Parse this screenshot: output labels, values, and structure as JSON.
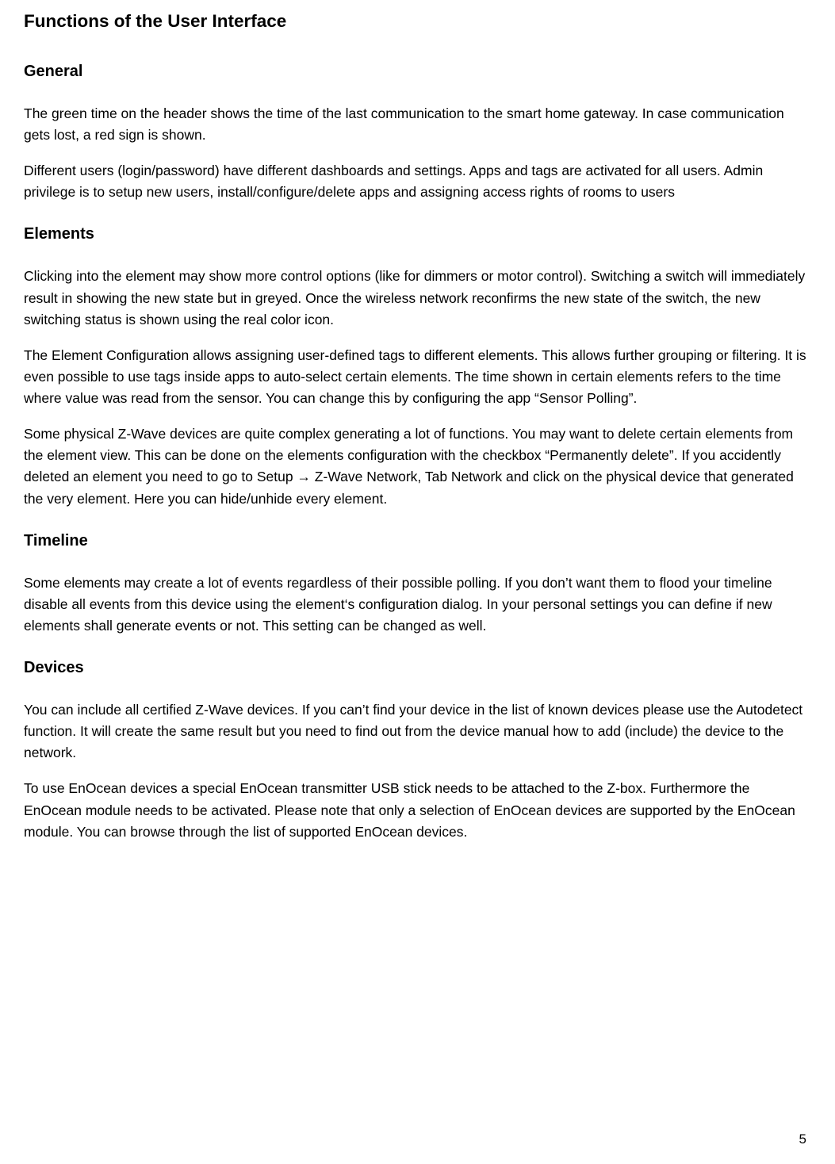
{
  "title": "Functions of the User Interface",
  "sections": {
    "general": {
      "heading": "General",
      "p1": "The green time on the header shows the time of the last communication to the smart home gateway. In case communication gets lost, a red sign is shown.",
      "p2": "Different users (login/password) have different dashboards and settings. Apps and tags  are activated for all users. Admin privilege is to setup new users, install/configure/delete apps and assigning access rights of rooms to users"
    },
    "elements": {
      "heading": "Elements",
      "p1": "Clicking into the element may show more control options (like for dimmers or motor control). Switching a switch will immediately result in showing the new state but in greyed. Once the wireless network reconfirms the new state of the switch, the new switching status is shown using the real color icon.",
      "p2": "The Element Configuration allows assigning user-defined tags to different elements. This allows further grouping or filtering. It is even possible to use tags  inside apps to auto-select certain  elements. The time shown in certain elements refers to the time where value was read  from the sensor. You can change this by configuring the app “Sensor Polling”.",
      "p3": "Some physical Z-Wave devices are quite complex generating a lot of functions. You may want to delete certain elements from the element view. This can be done on the elements configuration with the checkbox “Permanently delete”.  If you accidently deleted an element you need to go to Setup → Z-Wave Network, Tab Network and click on the physical device that generated the very element. Here you can hide/unhide every element."
    },
    "timeline": {
      "heading": "Timeline",
      "p1": "Some elements may create a lot of events regardless of their possible polling. If you don’t want them to flood your timeline disable all events from this device using the element‘s configuration dialog. In your personal settings you can define if new elements shall generate events or not. This setting can be changed as well."
    },
    "devices": {
      "heading": "Devices",
      "p1": "You can include all certified Z-Wave devices. If you can’t find your device in the list of known devices please use the Autodetect function. It will create the same result but you need to find out from the device manual how to add (include) the device to the network.",
      "p2": "To use EnOcean devices a special EnOcean transmitter USB stick needs to be attached to the Z-box. Furthermore the EnOcean module needs to be activated. Please note that only a selection of EnOcean devices are supported by the EnOcean module.  You can browse through the list of supported EnOcean devices."
    }
  },
  "pageNumber": "5"
}
